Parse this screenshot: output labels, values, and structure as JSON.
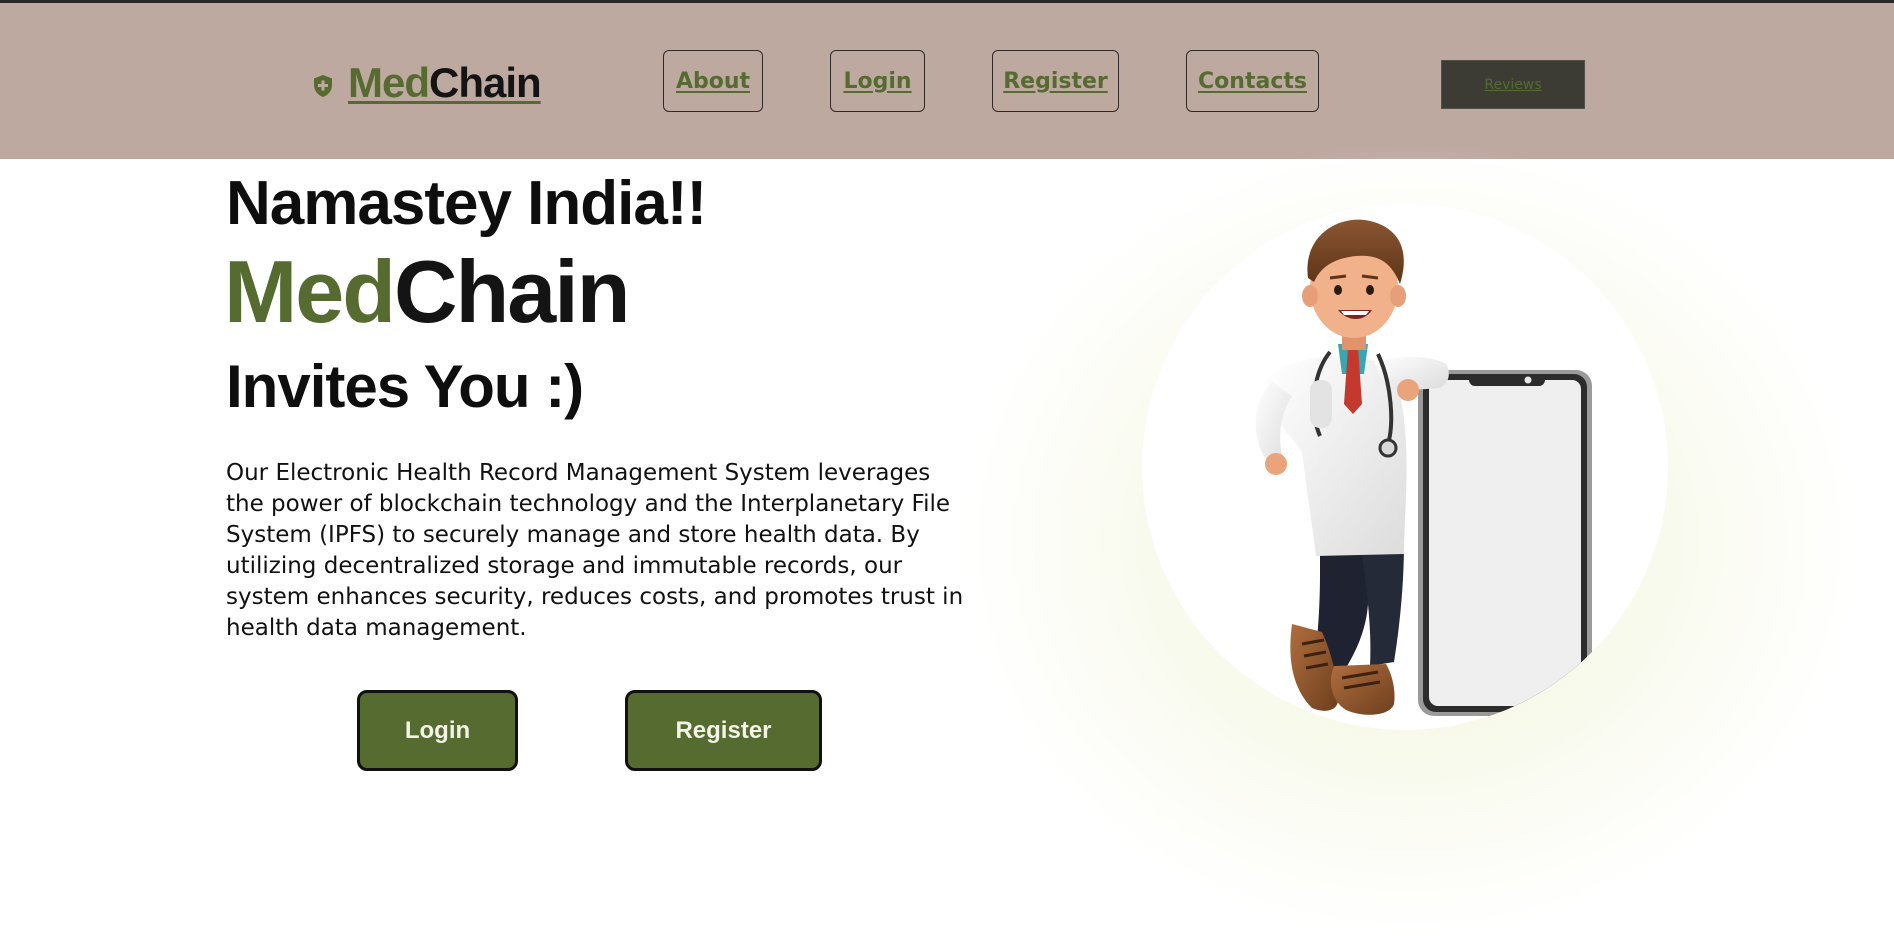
{
  "header": {
    "logo": {
      "icon": "shield-plus-icon",
      "brand_part1": "Med",
      "brand_part2": "Chain"
    },
    "nav": {
      "about": "About",
      "login": "Login",
      "register": "Register",
      "contacts": "Contacts",
      "reviews": "Reviews"
    }
  },
  "hero": {
    "greeting": "Namastey India!!",
    "brand_part1": "Med",
    "brand_part2": "Chain",
    "tagline": "Invites You :)",
    "description": "Our Electronic Health Record Management System leverages the power of blockchain technology and the Interplanetary File System (IPFS) to securely manage and store health data. By utilizing decentralized storage and immutable records, our system enhances security, reduces costs, and promotes trust in health data management.",
    "login_button": "Login",
    "register_button": "Register",
    "illustration": "doctor-with-phone-illustration"
  },
  "colors": {
    "header_bg": "#bea9a1",
    "accent_green": "#556b2f",
    "text_dark": "#141414",
    "reviews_bg": "#3c3c34"
  }
}
